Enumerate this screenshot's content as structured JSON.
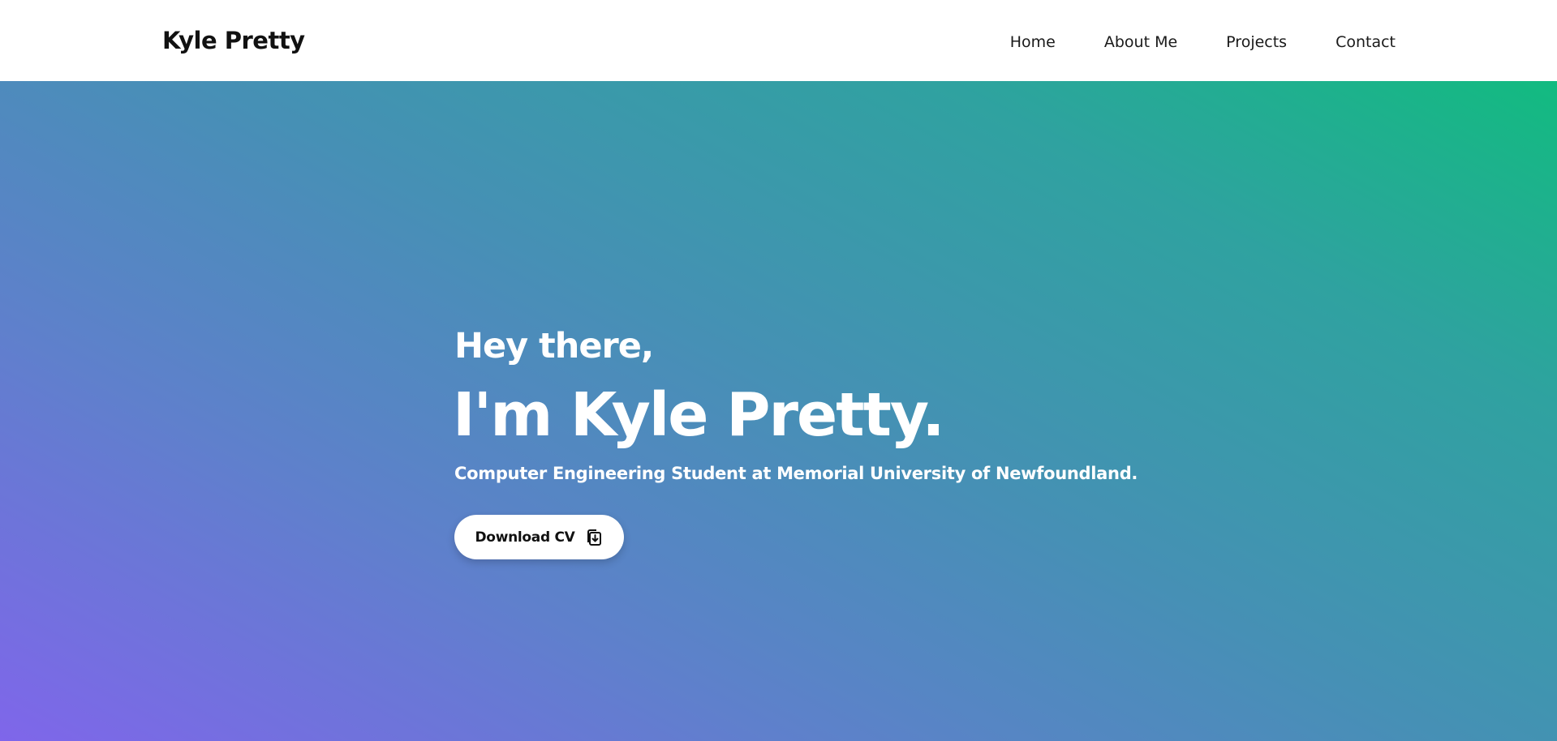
{
  "header": {
    "brand": "Kyle Pretty",
    "nav": [
      {
        "label": "Home"
      },
      {
        "label": "About Me"
      },
      {
        "label": "Projects"
      },
      {
        "label": "Contact"
      }
    ]
  },
  "hero": {
    "greeting": "Hey there,",
    "title": "I'm Kyle Pretty.",
    "tagline": "Computer Engineering Student at Memorial University of Newfoundland.",
    "cta_label": "Download CV",
    "cta_icon": "download-file-icon"
  },
  "colors": {
    "gradient_top_right": "#12bb80",
    "gradient_bottom_left": "#7f66ea",
    "nav_background": "#ffffff",
    "text_light": "#ffffff",
    "text_dark": "#111111"
  }
}
